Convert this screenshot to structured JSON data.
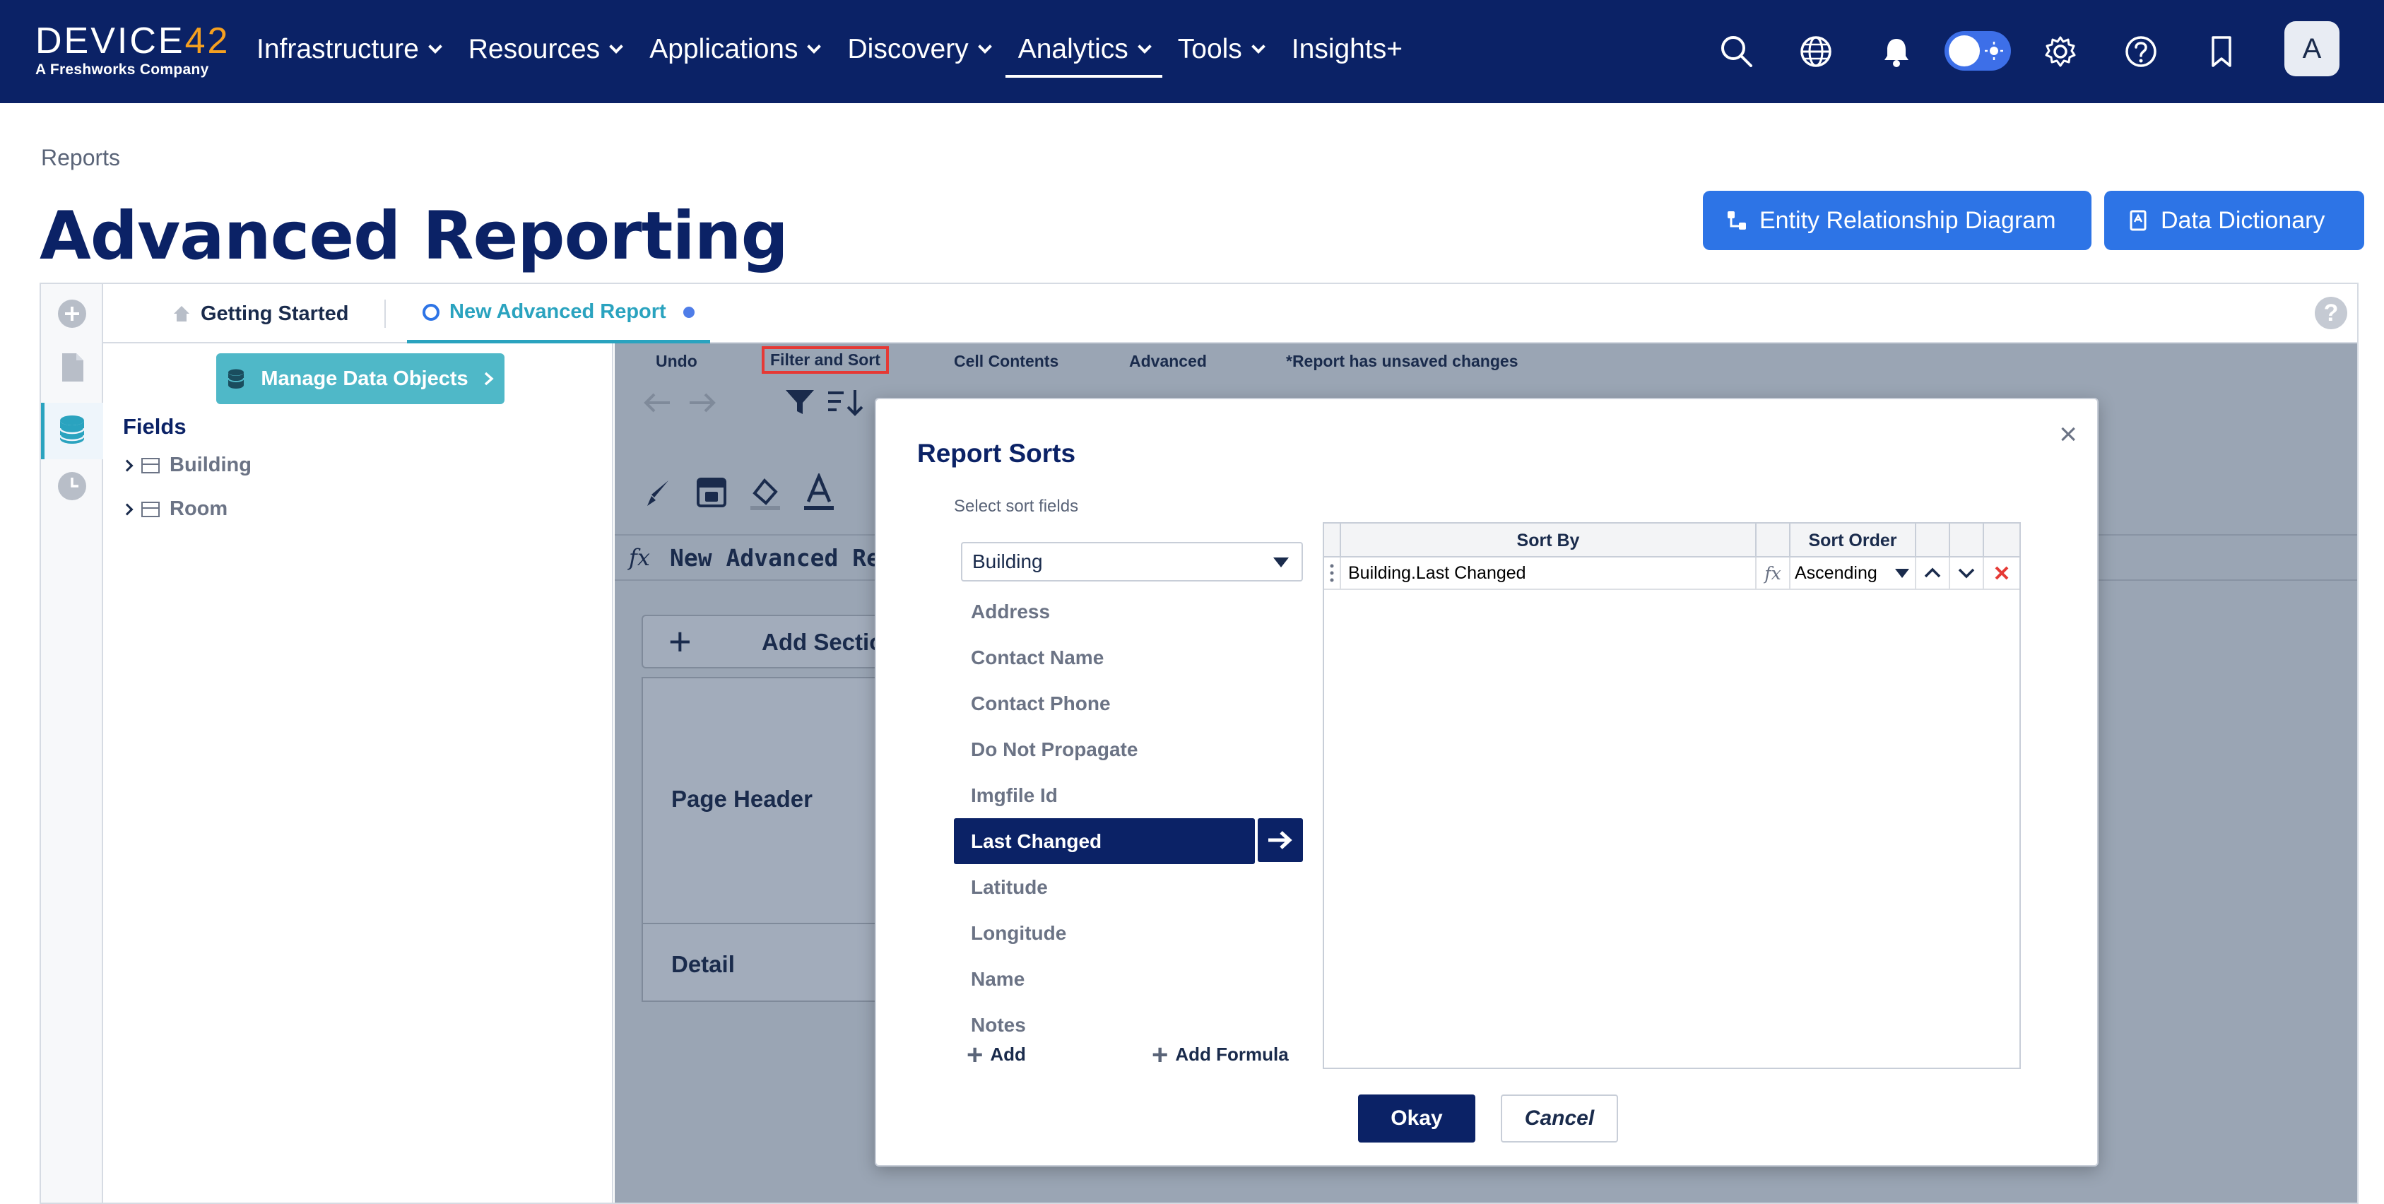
{
  "brand": {
    "logo_text_main": "DEVICE",
    "logo_text_accent": "42",
    "tagline": "A Freshworks Company"
  },
  "nav": {
    "items": [
      {
        "label": "Infrastructure",
        "has_dropdown": true
      },
      {
        "label": "Resources",
        "has_dropdown": true
      },
      {
        "label": "Applications",
        "has_dropdown": true
      },
      {
        "label": "Discovery",
        "has_dropdown": true
      },
      {
        "label": "Analytics",
        "has_dropdown": true,
        "active": true
      },
      {
        "label": "Tools",
        "has_dropdown": true
      },
      {
        "label": "Insights+",
        "has_dropdown": false
      }
    ],
    "icons": [
      "search-icon",
      "globe-icon",
      "bell-icon",
      "theme-toggle",
      "gear-icon",
      "help-icon",
      "bookmark-icon"
    ],
    "avatar_initial": "A"
  },
  "page": {
    "breadcrumb": "Reports",
    "title": "Advanced Reporting",
    "erd_button": "Entity Relationship Diagram",
    "dictionary_button": "Data Dictionary"
  },
  "tabs": {
    "getting_started": "Getting Started",
    "new_report": "New Advanced Report"
  },
  "fields_panel": {
    "manage_button": "Manage Data Objects",
    "title": "Fields",
    "tree": [
      "Building",
      "Room"
    ]
  },
  "workspace": {
    "toolbar_labels": {
      "undo": "Undo",
      "filter_sort": "Filter and Sort",
      "cell_contents": "Cell Contents",
      "advanced": "Advanced",
      "unsaved": "*Report has unsaved changes"
    },
    "formula_text": "New Advanced Re",
    "add_section": "Add Sectio",
    "page_header": "Page Header",
    "detail": "Detail"
  },
  "modal": {
    "title": "Report Sorts",
    "subtitle": "Select sort fields",
    "entity_select": "Building",
    "fields": [
      "Address",
      "Contact Name",
      "Contact Phone",
      "Do Not Propagate",
      "Imgfile Id",
      "Last Changed",
      "Latitude",
      "Longitude",
      "Name",
      "Notes"
    ],
    "selected_field": "Last Changed",
    "add_label": "Add",
    "add_formula_label": "Add Formula",
    "grid": {
      "col_sort_by": "Sort By",
      "col_sort_order": "Sort Order",
      "rows": [
        {
          "sort_by": "Building.Last Changed",
          "sort_order": "Ascending"
        }
      ]
    },
    "okay": "Okay",
    "cancel": "Cancel"
  },
  "colors": {
    "nav_bg": "#0b2266",
    "primary_blue": "#2d74e6",
    "teal": "#4fb8c8",
    "logo_accent": "#f5a020",
    "highlight_red": "#e53935"
  }
}
